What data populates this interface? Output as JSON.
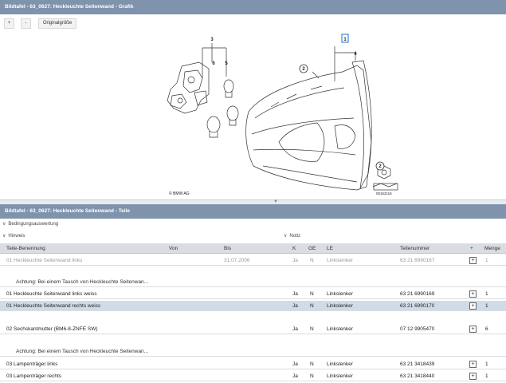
{
  "graphic_panel": {
    "title": "Bildtafel - 63_0627: Heckleuchte Seitenwand - Grafik",
    "toolbar": {
      "zoom_in": "+",
      "zoom_out": "-",
      "original_size": "Originalgröße"
    },
    "callouts": {
      "c1": "1",
      "c2": "2",
      "c3": "3",
      "c4": "4",
      "c5": "5",
      "c6": "6"
    },
    "copyright": "© BMW AG",
    "drawing_number": "00152116"
  },
  "parts_panel": {
    "title": "Bildtafel - 63_0627: Heckleuchte Seitenwand - Teile",
    "sections": {
      "conditions": "Bedingungsauswertung",
      "hint": "Hinweis",
      "note": "Notiz"
    },
    "columns": {
      "name": "Teile-Benennung",
      "from": "Von",
      "to": "Bis",
      "k": "K",
      "ge": "GE",
      "le": "LE",
      "part_number": "Teilenummer",
      "plus": "+",
      "qty": "Menge"
    },
    "rows": [
      {
        "name": "01 Heckleuchte Seitenwand links",
        "from": "",
        "to": "31.07.2006",
        "k": "Ja",
        "ge": "N",
        "le": "Linkslenker",
        "part_number": "63 21 6990167",
        "qty": "1"
      },
      {
        "note": "Achtung: Bei einem Tausch von Heckleuchte Seitenwan..."
      },
      {
        "name": "01 Heckleuchte Seitenwand links weiss",
        "from": "",
        "to": "",
        "k": "Ja",
        "ge": "N",
        "le": "Linkslenker",
        "part_number": "63 21 6990169",
        "qty": "1"
      },
      {
        "name": "01 Heckleuchte Seitenwand rechts weiss",
        "from": "",
        "to": "",
        "k": "Ja",
        "ge": "N",
        "le": "Linkslenker",
        "part_number": "63 21 6990170",
        "qty": "1"
      },
      {
        "name": "02 Sechskantmutter (BM6-8-ZNFE SW)",
        "from": "",
        "to": "",
        "k": "Ja",
        "ge": "N",
        "le": "Linkslenker",
        "part_number": "07 12 9905470",
        "qty": "6"
      },
      {
        "note": "Achtung: Bei einem Tausch von Heckleuchte Seitenwan..."
      },
      {
        "name": "03 Lampenträger links",
        "from": "",
        "to": "",
        "k": "Ja",
        "ge": "N",
        "le": "Linkslenker",
        "part_number": "63 21 3418439",
        "qty": "1"
      },
      {
        "name": "03 Lampenträger rechts",
        "from": "",
        "to": "",
        "k": "Ja",
        "ge": "N",
        "le": "Linkslenker",
        "part_number": "63 21 3418440",
        "qty": "1"
      }
    ]
  },
  "colors": {
    "header_bg": "#7f93ad",
    "selected_row": "#d0dbe8",
    "table_head": "#d9dde2"
  }
}
